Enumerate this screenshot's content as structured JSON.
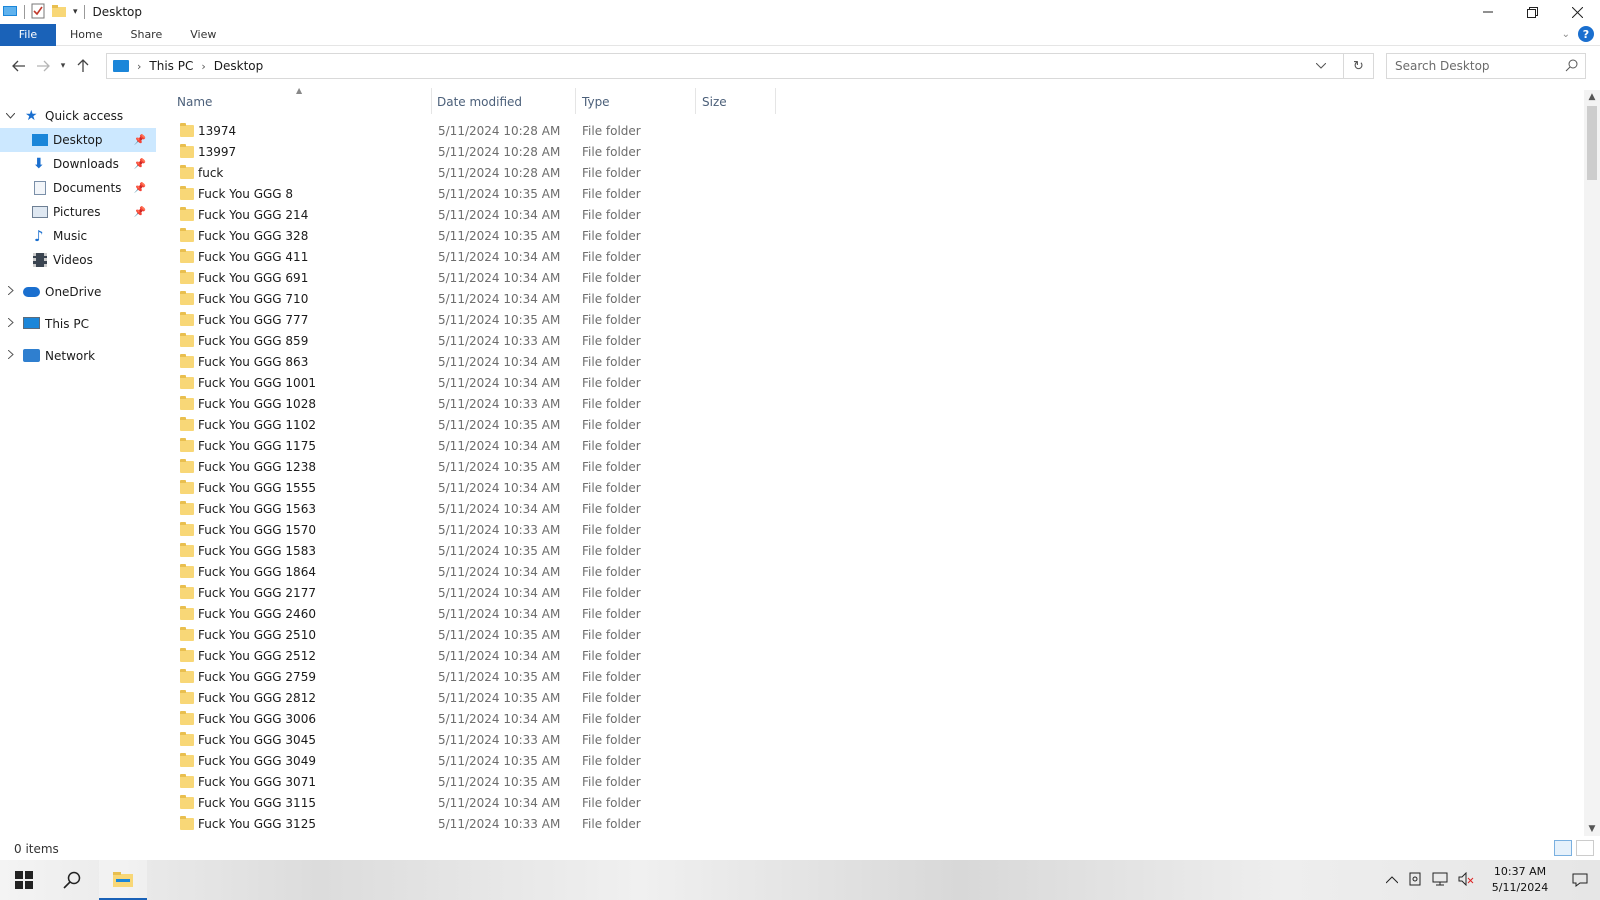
{
  "window": {
    "title": "Desktop"
  },
  "ribbon": {
    "tabs": [
      "File",
      "Home",
      "Share",
      "View"
    ]
  },
  "address": {
    "crumbs": [
      "This PC",
      "Desktop"
    ]
  },
  "search": {
    "placeholder": "Search Desktop"
  },
  "nav": {
    "quick_access": "Quick access",
    "items": [
      "Desktop",
      "Downloads",
      "Documents",
      "Pictures",
      "Music",
      "Videos"
    ],
    "onedrive": "OneDrive",
    "thispc": "This PC",
    "network": "Network"
  },
  "columns": {
    "name": "Name",
    "date": "Date modified",
    "type": "Type",
    "size": "Size"
  },
  "files": [
    {
      "name": "13974",
      "date": "5/11/2024 10:28 AM",
      "type": "File folder"
    },
    {
      "name": "13997",
      "date": "5/11/2024 10:28 AM",
      "type": "File folder"
    },
    {
      "name": "fuck",
      "date": "5/11/2024 10:28 AM",
      "type": "File folder"
    },
    {
      "name": "Fuck You GGG 8",
      "date": "5/11/2024 10:35 AM",
      "type": "File folder"
    },
    {
      "name": "Fuck You GGG 214",
      "date": "5/11/2024 10:34 AM",
      "type": "File folder"
    },
    {
      "name": "Fuck You GGG 328",
      "date": "5/11/2024 10:35 AM",
      "type": "File folder"
    },
    {
      "name": "Fuck You GGG 411",
      "date": "5/11/2024 10:34 AM",
      "type": "File folder"
    },
    {
      "name": "Fuck You GGG 691",
      "date": "5/11/2024 10:34 AM",
      "type": "File folder"
    },
    {
      "name": "Fuck You GGG 710",
      "date": "5/11/2024 10:34 AM",
      "type": "File folder"
    },
    {
      "name": "Fuck You GGG 777",
      "date": "5/11/2024 10:35 AM",
      "type": "File folder"
    },
    {
      "name": "Fuck You GGG 859",
      "date": "5/11/2024 10:33 AM",
      "type": "File folder"
    },
    {
      "name": "Fuck You GGG 863",
      "date": "5/11/2024 10:34 AM",
      "type": "File folder"
    },
    {
      "name": "Fuck You GGG 1001",
      "date": "5/11/2024 10:34 AM",
      "type": "File folder"
    },
    {
      "name": "Fuck You GGG 1028",
      "date": "5/11/2024 10:33 AM",
      "type": "File folder"
    },
    {
      "name": "Fuck You GGG 1102",
      "date": "5/11/2024 10:35 AM",
      "type": "File folder"
    },
    {
      "name": "Fuck You GGG 1175",
      "date": "5/11/2024 10:34 AM",
      "type": "File folder"
    },
    {
      "name": "Fuck You GGG 1238",
      "date": "5/11/2024 10:35 AM",
      "type": "File folder"
    },
    {
      "name": "Fuck You GGG 1555",
      "date": "5/11/2024 10:34 AM",
      "type": "File folder"
    },
    {
      "name": "Fuck You GGG 1563",
      "date": "5/11/2024 10:34 AM",
      "type": "File folder"
    },
    {
      "name": "Fuck You GGG 1570",
      "date": "5/11/2024 10:33 AM",
      "type": "File folder"
    },
    {
      "name": "Fuck You GGG 1583",
      "date": "5/11/2024 10:35 AM",
      "type": "File folder"
    },
    {
      "name": "Fuck You GGG 1864",
      "date": "5/11/2024 10:34 AM",
      "type": "File folder"
    },
    {
      "name": "Fuck You GGG 2177",
      "date": "5/11/2024 10:34 AM",
      "type": "File folder"
    },
    {
      "name": "Fuck You GGG 2460",
      "date": "5/11/2024 10:34 AM",
      "type": "File folder"
    },
    {
      "name": "Fuck You GGG 2510",
      "date": "5/11/2024 10:35 AM",
      "type": "File folder"
    },
    {
      "name": "Fuck You GGG 2512",
      "date": "5/11/2024 10:34 AM",
      "type": "File folder"
    },
    {
      "name": "Fuck You GGG 2759",
      "date": "5/11/2024 10:35 AM",
      "type": "File folder"
    },
    {
      "name": "Fuck You GGG 2812",
      "date": "5/11/2024 10:35 AM",
      "type": "File folder"
    },
    {
      "name": "Fuck You GGG 3006",
      "date": "5/11/2024 10:34 AM",
      "type": "File folder"
    },
    {
      "name": "Fuck You GGG 3045",
      "date": "5/11/2024 10:33 AM",
      "type": "File folder"
    },
    {
      "name": "Fuck You GGG 3049",
      "date": "5/11/2024 10:35 AM",
      "type": "File folder"
    },
    {
      "name": "Fuck You GGG 3071",
      "date": "5/11/2024 10:35 AM",
      "type": "File folder"
    },
    {
      "name": "Fuck You GGG 3115",
      "date": "5/11/2024 10:34 AM",
      "type": "File folder"
    },
    {
      "name": "Fuck You GGG 3125",
      "date": "5/11/2024 10:33 AM",
      "type": "File folder"
    }
  ],
  "status": {
    "items": "0 items"
  },
  "taskbar": {
    "time": "10:37 AM",
    "date": "5/11/2024"
  },
  "colors": {
    "accent": "#1a62b8",
    "selection": "#cce8ff",
    "folder": "#f8d777"
  }
}
